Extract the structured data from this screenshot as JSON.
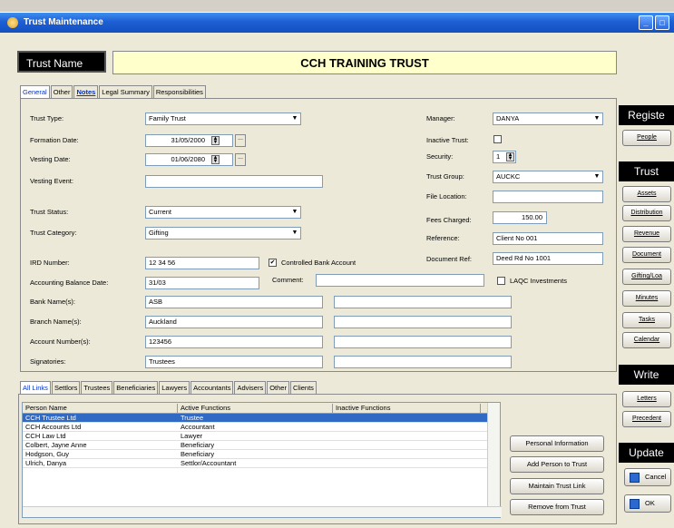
{
  "window": {
    "title": "Trust Maintenance",
    "min_glyph": "_",
    "close_glyph": "□"
  },
  "trust_name": {
    "label": "Trust Name",
    "value": "CCH TRAINING TRUST"
  },
  "tabs": [
    "General",
    "Other",
    "Notes",
    "Legal Summary",
    "Responsibilities"
  ],
  "form": {
    "trust_type": {
      "label": "Trust Type:",
      "value": "Family Trust"
    },
    "formation_date": {
      "label": "Formation Date:",
      "value": "31/05/2000"
    },
    "vesting_date": {
      "label": "Vesting Date:",
      "value": "01/06/2080"
    },
    "vesting_event": {
      "label": "Vesting Event:",
      "value": ""
    },
    "trust_status": {
      "label": "Trust Status:",
      "value": "Current"
    },
    "trust_category": {
      "label": "Trust Category:",
      "value": "Gifting"
    },
    "ird_number": {
      "label": "IRD Number:",
      "value": "12    34    56"
    },
    "controlled_bank": {
      "label": "Controlled Bank Account",
      "checked": true
    },
    "balance_date": {
      "label": "Accounting Balance Date:",
      "value": "31/03"
    },
    "comment": {
      "label": "Comment:",
      "value": ""
    },
    "bank_name": {
      "label": "Bank Name(s):",
      "value": "ASB"
    },
    "branch_name": {
      "label": "Branch Name(s):",
      "value": "Auckland"
    },
    "account_number": {
      "label": "Account Number(s):",
      "value": "123456"
    },
    "signatories": {
      "label": "Signatories:",
      "value": "Trustees"
    },
    "manager": {
      "label": "Manager:",
      "value": "DANYA"
    },
    "inactive_trust": {
      "label": "Inactive Trust:",
      "checked": false
    },
    "security": {
      "label": "Security:",
      "value": "1"
    },
    "trust_group": {
      "label": "Trust Group:",
      "value": "AUCKC"
    },
    "file_location": {
      "label": "File Location:",
      "value": ""
    },
    "fees_charged": {
      "label": "Fees Charged:",
      "value": "150.00"
    },
    "reference": {
      "label": "Reference:",
      "value": "Client No 001"
    },
    "document_ref": {
      "label": "Document Ref:",
      "value": "Deed Rd No 1001"
    },
    "laqc": {
      "label": "LAQC Investments",
      "checked": false
    }
  },
  "sidebar": {
    "register_head": "Registe",
    "register_items": [
      "People"
    ],
    "trust_head": "Trust",
    "trust_items": [
      "Assets",
      "Distribution",
      "Revenue",
      "Document",
      "Gifting/Loa",
      "Minutes",
      "Tasks",
      "Calendar"
    ],
    "write_head": "Write",
    "write_items": [
      "Letters",
      "Precedent"
    ],
    "update_head": "Update",
    "cancel_label": "Cancel",
    "ok_label": "OK"
  },
  "link_tabs": [
    "All Links",
    "Settlors",
    "Trustees",
    "Beneficiaries",
    "Lawyers",
    "Accountants",
    "Advisers",
    "Other",
    "Clients"
  ],
  "links_table": {
    "columns": [
      "Person Name",
      "Active Functions",
      "Inactive Functions"
    ],
    "rows": [
      [
        "CCH Trustee Ltd",
        "Trustee",
        ""
      ],
      [
        "CCH Accounts Ltd",
        "Accountant",
        ""
      ],
      [
        "CCH Law Ltd",
        "Lawyer",
        ""
      ],
      [
        "Colbert, Jayne Anne",
        "Beneficiary",
        ""
      ],
      [
        "Hodgson, Guy",
        "Beneficiary",
        ""
      ],
      [
        "Ulrich, Danya",
        "Settlor/Accountant",
        ""
      ]
    ],
    "selected_row": 0
  },
  "actions": [
    "Personal Information",
    "Add Person to Trust",
    "Maintain Trust Link",
    "Remove from Trust"
  ]
}
